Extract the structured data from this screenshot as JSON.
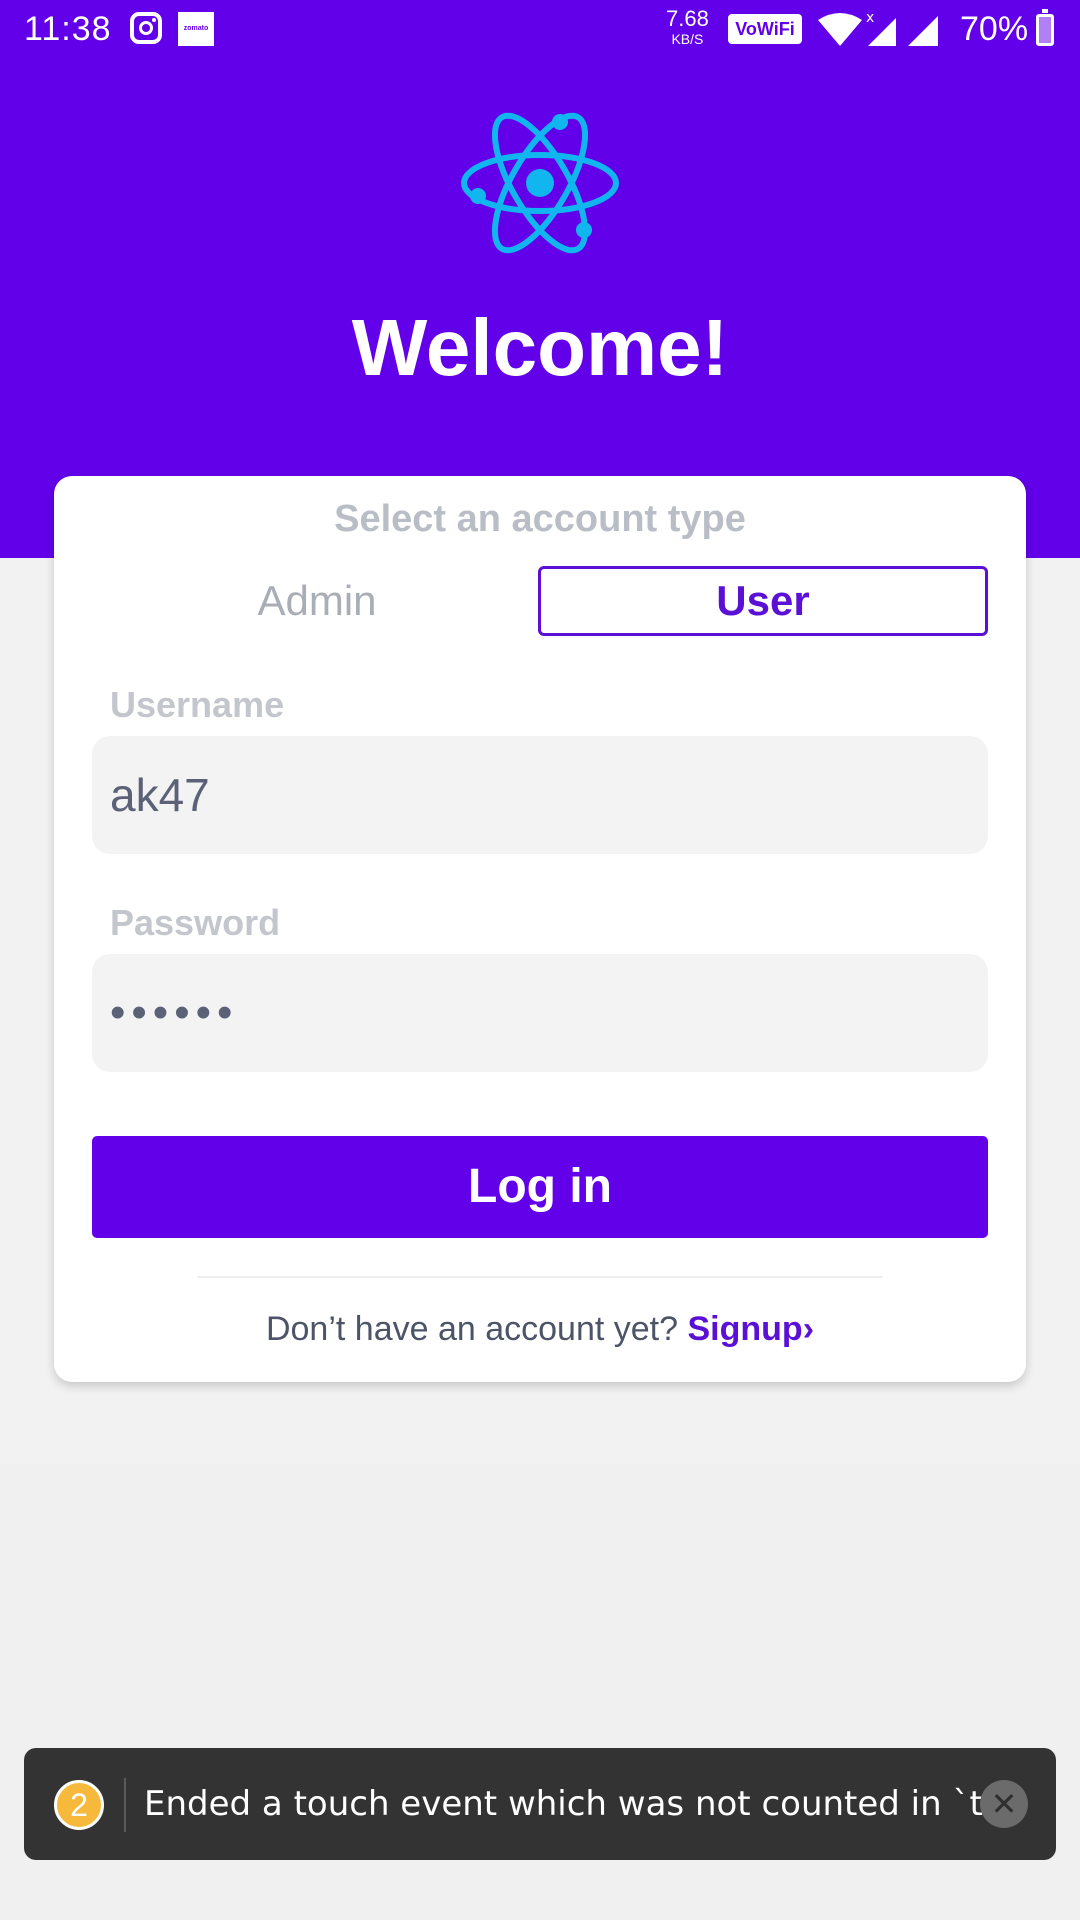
{
  "status_bar": {
    "time": "11:38",
    "network_speed_value": "7.68",
    "network_speed_unit": "KB/S",
    "wifi_badge": "VoWiFi",
    "battery": "70%",
    "icons": [
      "instagram-icon",
      "zomato-icon",
      "wifi-icon",
      "signal-icon",
      "battery-icon"
    ]
  },
  "header": {
    "title": "Welcome!",
    "logo_icon": "react-atom-icon",
    "background": "#6200ea"
  },
  "account_type": {
    "label": "Select an account type",
    "options": [
      "Admin",
      "User"
    ],
    "selected": "User"
  },
  "username": {
    "label": "Username",
    "value": "ak47"
  },
  "password": {
    "label": "Password",
    "value": "••••••"
  },
  "login_button": "Log in",
  "signup": {
    "prompt": "Don’t have an account yet?",
    "link": "Signup",
    "chevron": "›"
  },
  "toast": {
    "count": "2",
    "message": "Ended a touch event which was not counted in `trac...",
    "close": "✕"
  },
  "colors": {
    "accent": "#6200ea",
    "selected_text": "#5b10d6",
    "toast_bg": "#333333",
    "badge": "#f6b93b"
  }
}
